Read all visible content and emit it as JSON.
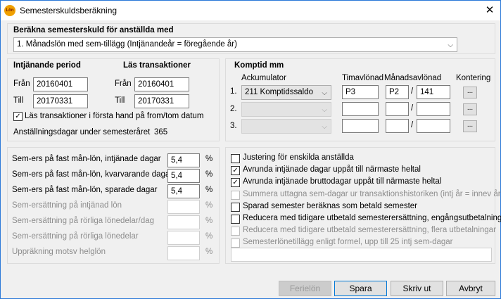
{
  "window": {
    "title": "Semesterskuldsberäkning",
    "icon_text": "Lön",
    "close_symbol": "✕"
  },
  "method": {
    "heading": "Beräkna semesterskuld för anställda med",
    "selected": "1.   Månadslön med sem-tillägg (Intjänandeår = föregående år)"
  },
  "earning": {
    "heading": "Intjänande period",
    "from_label": "Från",
    "from": "20160401",
    "to_label": "Till",
    "to": "20170331"
  },
  "reading": {
    "heading": "Läs transaktioner",
    "from_label": "Från",
    "from": "20160401",
    "to_label": "Till",
    "to": "20170331"
  },
  "read_first_label": "Läs transaktioner i första hand på from/tom datum",
  "read_first_checked": "✓",
  "employment_days": {
    "label": "Anställningsdagar under semesteråret",
    "value": "365"
  },
  "comp": {
    "heading": "Komptid mm",
    "col_acc": "Ackumulator",
    "col_hour": "Timavlönad",
    "col_month": "Månadsavlönad",
    "col_acct": "Kontering",
    "slash": "/",
    "dots": "...",
    "rows": [
      {
        "num": "1.",
        "acc": "211 Komptidssaldo",
        "hour": "P3",
        "m1": "P2",
        "m2": "141"
      },
      {
        "num": "2.",
        "acc": "",
        "hour": "",
        "m1": "",
        "m2": ""
      },
      {
        "num": "3.",
        "acc": "",
        "hour": "",
        "m1": "",
        "m2": ""
      }
    ]
  },
  "rates": {
    "unit": "%",
    "rows": [
      {
        "label": "Sem-ers på fast mån-lön, intjänade dagar",
        "value": "5,4"
      },
      {
        "label": "Sem-ers på fast mån-lön, kvarvarande dagar",
        "value": "5,4"
      },
      {
        "label": "Sem-ers på fast mån-lön, sparade dagar",
        "value": "5,4"
      },
      {
        "label": "Sem-ersättning på intjänad lön",
        "value": ""
      },
      {
        "label": "Sem-ersättning på rörliga lönedelar/dag",
        "value": ""
      },
      {
        "label": "Sem-ersättning på rörliga lönedelar",
        "value": ""
      },
      {
        "label": "Uppräkning motsv helglön",
        "value": ""
      }
    ]
  },
  "options": {
    "check": "✓",
    "rows": [
      {
        "label": "Justering för enskilda anställda",
        "checked": false,
        "disabled": false
      },
      {
        "label": "Avrunda intjänade dagar uppåt till närmaste heltal",
        "checked": true,
        "disabled": false
      },
      {
        "label": "Avrunda intjänade bruttodagar uppåt till närmaste heltal",
        "checked": true,
        "disabled": false
      },
      {
        "label": "Summera uttagna sem-dagar ur transaktionshistoriken (intj år = innev år)",
        "checked": false,
        "disabled": true
      },
      {
        "label": "Sparad semester beräknas som betald semester",
        "checked": false,
        "disabled": false
      },
      {
        "label": "Reducera med tidigare utbetald semesterersättning, engångsutbetalning",
        "checked": false,
        "disabled": false
      },
      {
        "label": "Reducera med tidigare utbetald semesterersättning, flera utbetalningar",
        "checked": false,
        "disabled": true
      },
      {
        "label": "Semesterlönetillägg enligt formel, upp till 25 intj sem-dagar",
        "checked": false,
        "disabled": true
      }
    ],
    "formula": ""
  },
  "buttons": {
    "errors": "Ferielön",
    "save": "Spara",
    "print": "Skriv ut",
    "cancel": "Avbryt"
  }
}
